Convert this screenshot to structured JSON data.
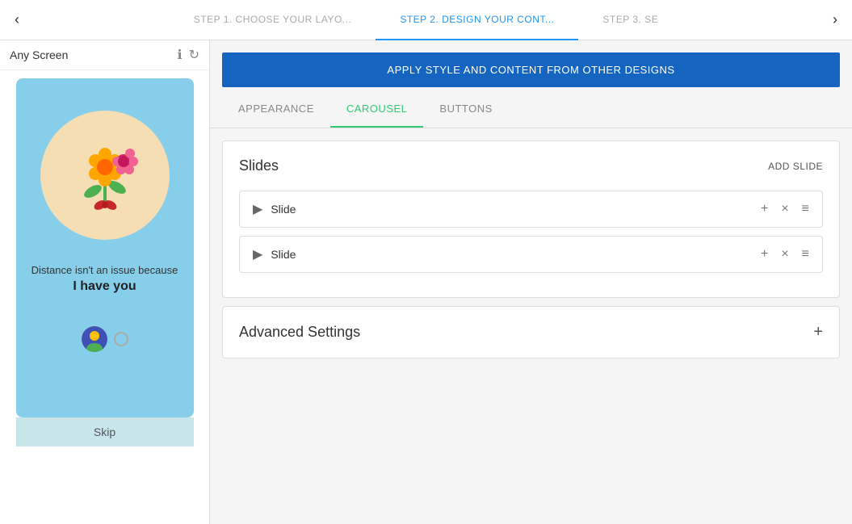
{
  "nav": {
    "prev_arrow": "‹",
    "next_arrow": "›",
    "steps": [
      {
        "id": "step1",
        "label": "STEP 1. CHOOSE YOUR LAYO...",
        "active": false
      },
      {
        "id": "step2",
        "label": "STEP 2. DESIGN YOUR CONT...",
        "active": true
      },
      {
        "id": "step3",
        "label": "STEP 3. SE",
        "active": false
      }
    ]
  },
  "left_panel": {
    "screen_title": "Any Screen",
    "info_icon": "ℹ",
    "refresh_icon": "↻",
    "phone": {
      "text1": "Distance isn't an issue because",
      "text2": "I have you",
      "skip_label": "Skip"
    }
  },
  "right_panel": {
    "apply_banner": {
      "label": "APPLY STYLE AND CONTENT FROM OTHER DESIGNS"
    },
    "tabs": [
      {
        "id": "appearance",
        "label": "APPEARANCE",
        "active": false
      },
      {
        "id": "carousel",
        "label": "CAROUSEL",
        "active": true
      },
      {
        "id": "buttons",
        "label": "BUTTONS",
        "active": false
      }
    ],
    "slides_section": {
      "title": "Slides",
      "add_btn": "ADD SLIDE",
      "slides": [
        {
          "id": "slide1",
          "label": "Slide"
        },
        {
          "id": "slide2",
          "label": "Slide"
        }
      ]
    },
    "advanced_section": {
      "title": "Advanced Settings",
      "plus_icon": "+"
    }
  },
  "icons": {
    "play": "▶",
    "plus": "+",
    "close": "×",
    "menu": "≡"
  }
}
